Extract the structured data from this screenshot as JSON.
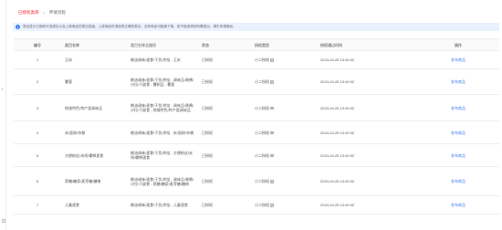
{
  "breadcrumb": {
    "link": "已授权类目",
    "separator": "/",
    "current": "申请流程"
  },
  "notice": {
    "icon": "info-icon",
    "text": "类目显示已授权可选类目以及上架商品的类目层级，上架商品时请选择正确的类目，否则商品可能被下架。若不能选择到所需类目，请先申请授权。"
  },
  "table": {
    "headers": [
      "编号",
      "类目名称",
      "类目名称全路径",
      "状态",
      "授权类型",
      "授权通过时间",
      "操作"
    ],
    "rows": [
      {
        "num": "1",
        "name": "玉米",
        "path": "粮油调味/速食/干货/烘焙 - 玉米",
        "status": "已授权",
        "type": "小二授权",
        "time": "2024-04-25 13:49:32",
        "op": "发布商品"
      },
      {
        "num": "2",
        "name": "薯蓉",
        "path": "粮油调味/速食/干货/烘焙 - 调味品/果酱/沙拉/干副食 - 薯制品 - 薯蓉",
        "status": "已授权",
        "type": "小二授权",
        "time": "2024-04-25 13:49:32",
        "op": "发布商品"
      },
      {
        "num": "3",
        "name": "地域特色/特产类调味品",
        "path": "粮油调味/速食/干货/烘焙 - 调味品/果酱/沙拉/干副食 - 地域特色/特产类调味品",
        "status": "已授权",
        "type": "小二授权",
        "time": "2024-04-25 13:49:32",
        "op": "发布商品"
      },
      {
        "num": "4",
        "name": "米/面粉/杂粮",
        "path": "粮油调味/速食/干货/烘焙 - 米/面粉/杂粮",
        "status": "已授权",
        "type": "小二授权",
        "time": "2024-04-25 13:49:32",
        "op": "发布商品"
      },
      {
        "num": "5",
        "name": "方便粉丝/米线/螺蛳速食",
        "path": "粮油调味/速食/干货/烘焙 - 方便粉丝/米线/螺蛳速食",
        "status": "已授权",
        "type": "小二授权",
        "time": "2024-04-25 13:49:32",
        "op": "发布商品"
      },
      {
        "num": "6",
        "name": "蔗糖/糖浆/麦芽糖/糖稀",
        "path": "粮油调味/速食/干货/烘焙 - 调味品/果酱/沙拉/干副食 - 蔗糖/糖浆/麦芽糖/糖稀",
        "status": "已授权",
        "type": "小二授权",
        "time": "2024-04-25 13:49:32",
        "op": "发布商品"
      },
      {
        "num": "7",
        "name": "儿童速食",
        "path": "粮油调味/速食/干货/烘焙 - 儿童速食",
        "status": "已授权",
        "type": "小二授权",
        "time": "2024-04-25 13:49:32",
        "op": "发布商品"
      }
    ]
  }
}
